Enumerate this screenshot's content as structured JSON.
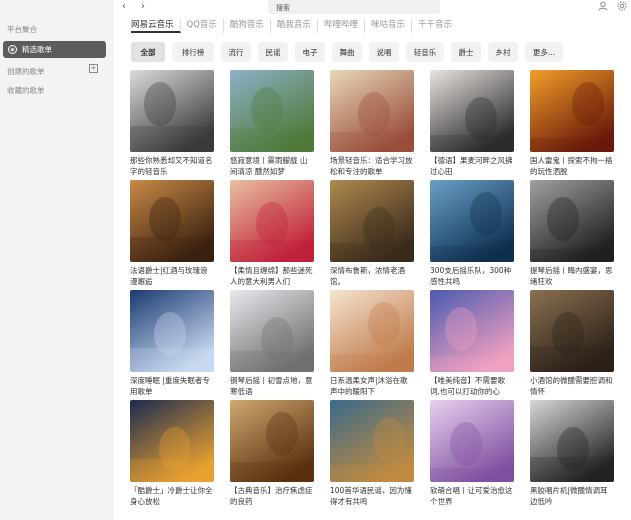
{
  "sidebar": {
    "section_platform": "平台聚合",
    "active_item": "精选歌单",
    "created": "创建的歌单",
    "collected": "收藏的歌单"
  },
  "topbar": {
    "back": "‹",
    "forward": "›",
    "search_placeholder": "搜索",
    "user_icon": "user-icon",
    "settings_icon": "gear-icon"
  },
  "tabs": [
    "网易云音乐",
    "QQ音乐",
    "酷狗音乐",
    "酷我音乐",
    "哔哩哔哩",
    "咪咕音乐",
    "千千音乐"
  ],
  "categories": [
    "全部",
    "排行榜",
    "流行",
    "民谣",
    "电子",
    "舞曲",
    "说唱",
    "轻音乐",
    "爵士",
    "乡村",
    "更多..."
  ],
  "playlists": [
    {
      "title": "那些你熟悉却又不知道名字的轻音乐",
      "colors": [
        "#dcdcdc",
        "#3a3a3a"
      ]
    },
    {
      "title": "悠寂意境丨雾雨朦胧 山间清凉 醺然如梦",
      "colors": [
        "#8fb0c8",
        "#4f7a3a"
      ]
    },
    {
      "title": "场景轻音乐：适合学习放松和专注的歌单",
      "colors": [
        "#e8d8b8",
        "#9a4e3a"
      ]
    },
    {
      "title": "【德语】果麦河畔之风拂过心田",
      "colors": [
        "#e9e4e1",
        "#2b2b2b"
      ]
    },
    {
      "title": "国人雷鬼丨探索不拘一格的玩性洒脱",
      "colors": [
        "#f29e2a",
        "#6a1a0a"
      ]
    },
    {
      "title": "法语爵士|红酒与玫瑰浪漫邂逅",
      "colors": [
        "#c98a46",
        "#3a2010"
      ]
    },
    {
      "title": "【柔情且缠绵】那些迷死人的意大利男人们",
      "colors": [
        "#e9c0a0",
        "#c0203a"
      ]
    },
    {
      "title": "深情布鲁斯，浓情老酒馆。",
      "colors": [
        "#b08a50",
        "#3a2a1a"
      ]
    },
    {
      "title": "300支后摇乐队，300种感性共鸣",
      "colors": [
        "#6aa0c8",
        "#0e3050"
      ]
    },
    {
      "title": "提琴后摇丨晦内盛宴，思绪狂欢",
      "colors": [
        "#a0a0a0",
        "#202020"
      ]
    },
    {
      "title": "深度睡眠 |重度失眠者专用歌单",
      "colors": [
        "#1a3a70",
        "#c8d8f0"
      ]
    },
    {
      "title": "钢琴后摇丨初雪点地，意寒低语",
      "colors": [
        "#e8e8ee",
        "#707070"
      ]
    },
    {
      "title": "日系温柔女声|沐浴在歌声中的暖阳下",
      "colors": [
        "#f4e4d0",
        "#c07a4a"
      ]
    },
    {
      "title": "【唯美纯音】不需要歌词,也可以打动你的心",
      "colors": [
        "#4a5ab0",
        "#f0a0c0"
      ]
    },
    {
      "title": "小酒馆的微醺需要腔调和情怀",
      "colors": [
        "#8a7050",
        "#2a2018"
      ]
    },
    {
      "title": "「酷爵士」冷爵士让你全身心放松",
      "colors": [
        "#1a2a50",
        "#e8a030"
      ]
    },
    {
      "title": "【古典音乐】治疗焦虑症的良药",
      "colors": [
        "#d0a870",
        "#5a3010"
      ]
    },
    {
      "title": "100首华语民谣，因为懂得才有共鸣",
      "colors": [
        "#3a6a8a",
        "#c08a40"
      ]
    },
    {
      "title": "软萌合唱丨让可爱治愈这个世界",
      "colors": [
        "#e8d0f0",
        "#8050a0"
      ]
    },
    {
      "title": "黑胶唱片机|微醺情调耳边低吟",
      "colors": [
        "#d8d8d8",
        "#222222"
      ]
    }
  ]
}
